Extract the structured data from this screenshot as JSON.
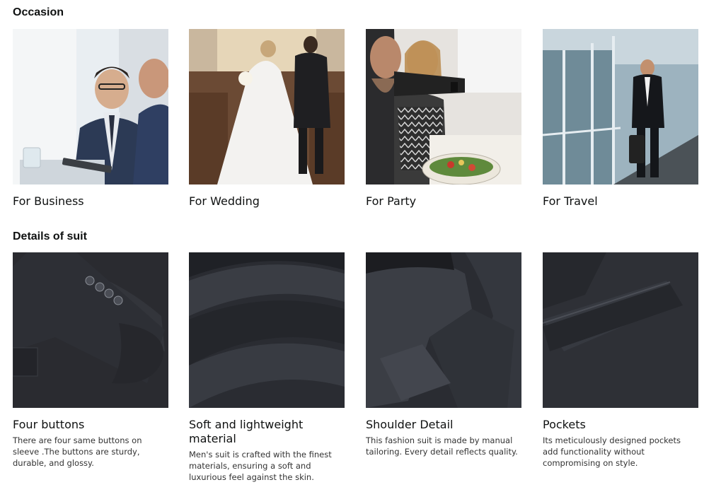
{
  "occasion": {
    "title": "Occasion",
    "items": [
      {
        "label": "For Business"
      },
      {
        "label": "For Wedding"
      },
      {
        "label": "For Party"
      },
      {
        "label": "For Travel"
      }
    ]
  },
  "details": {
    "title": "Details of suit",
    "items": [
      {
        "label": "Four buttons",
        "desc": "There are four same buttons on sleeve .The buttons are sturdy, durable, and glossy."
      },
      {
        "label": "Soft and lightweight material",
        "desc": "Men's suit is crafted with the finest materials, ensuring a soft and luxurious feel against the skin."
      },
      {
        "label": "Shoulder Detail",
        "desc": "This fashion suit is made by manual tailoring. Every detail reflects quality."
      },
      {
        "label": "Pockets",
        "desc": "Its meticulously designed pockets add functionality without compromising on style."
      }
    ]
  }
}
